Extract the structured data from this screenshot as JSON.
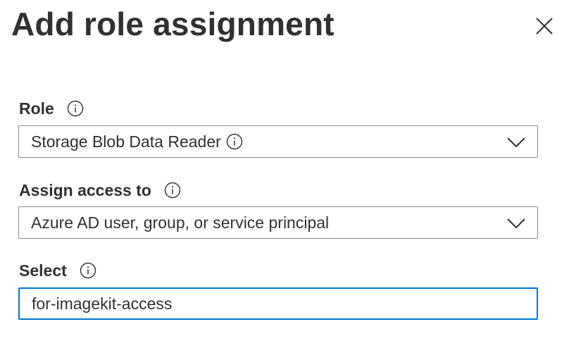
{
  "panel": {
    "title": "Add role assignment",
    "close_icon": "close-icon"
  },
  "role": {
    "label": "Role",
    "value": "Storage Blob Data Reader",
    "info_icon": "info-icon",
    "dropdown_icon": "chevron-down-icon"
  },
  "assign_access": {
    "label": "Assign access to",
    "value": "Azure AD user, group, or service principal",
    "info_icon": "info-icon",
    "dropdown_icon": "chevron-down-icon"
  },
  "select": {
    "label": "Select",
    "value": "for-imagekit-access",
    "info_icon": "info-icon"
  },
  "colors": {
    "text": "#323130",
    "border": "#8a8886",
    "focus_border": "#0078d4",
    "background": "#ffffff"
  }
}
